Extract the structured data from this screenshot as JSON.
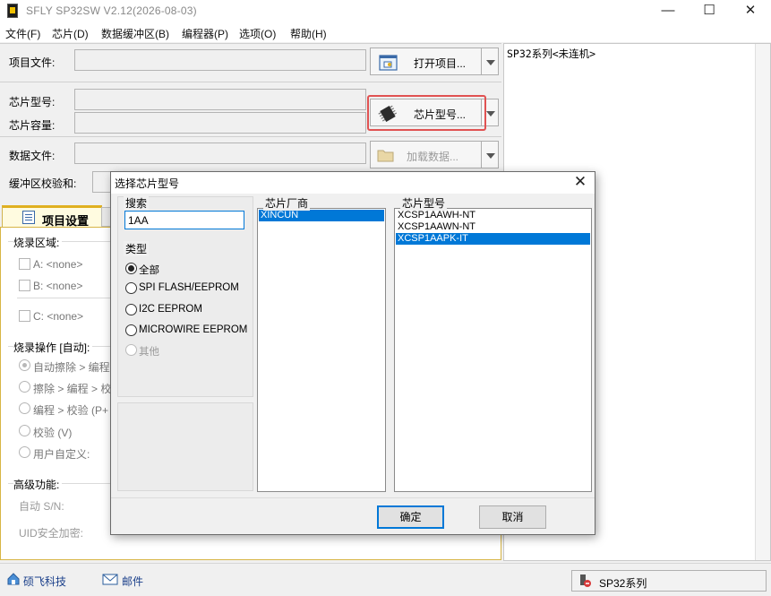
{
  "window": {
    "title": "SFLY SP32SW V2.12(2026-08-03)",
    "minimize": "—",
    "maximize": "☐",
    "close": "✕"
  },
  "menu": [
    "文件(F)",
    "芯片(D)",
    "数据缓冲区(B)",
    "编程器(P)",
    "选项(O)",
    "帮助(H)"
  ],
  "left": {
    "project_file_label": "项目文件:",
    "open_project_btn": "打开项目...",
    "chip_model_label": "芯片型号:",
    "chip_capacity_label": "芯片容量:",
    "chip_model_btn": "芯片型号...",
    "data_file_label": "数据文件:",
    "load_data_btn": "加载数据...",
    "buffer_checksum_label": "缓冲区校验和:"
  },
  "tabs": {
    "project_settings": "项目设置"
  },
  "settings": {
    "burn_area_title": "烧录区域:",
    "area_a": "A: <none>",
    "area_b": "B: <none>",
    "area_c": "C: <none>",
    "burn_ops_title": "烧录操作 [自动]:",
    "op1": "自动擦除 > 编程",
    "op2": "擦除 > 编程 > 校",
    "op3": "编程 > 校验 (P+",
    "op4": "校验 (V)",
    "op5": "用户自定义:",
    "advanced_title": "高级功能:",
    "auto_sn": "自动 S/N:",
    "uid_encrypt": "UID安全加密:"
  },
  "output": {
    "text": "SP32系列<未连机>"
  },
  "statusbar": {
    "company": "硕飞科技",
    "mail": "邮件",
    "device": "SP32系列"
  },
  "dialog": {
    "title": "选择芯片型号",
    "close": "✕",
    "search_label": "搜索",
    "search_value": "1AA",
    "type_label": "类型",
    "types": [
      {
        "label": "全部",
        "selected": true,
        "disabled": false
      },
      {
        "label": "SPI FLASH/EEPROM",
        "selected": false,
        "disabled": false
      },
      {
        "label": "I2C EEPROM",
        "selected": false,
        "disabled": false
      },
      {
        "label": "MICROWIRE EEPROM",
        "selected": false,
        "disabled": false
      },
      {
        "label": "其他",
        "selected": false,
        "disabled": true
      }
    ],
    "vendor_label": "芯片厂商",
    "vendors": [
      {
        "name": "XINCUN",
        "selected": true
      }
    ],
    "model_label": "芯片型号",
    "models": [
      {
        "name": "XCSP1AAWH-NT",
        "selected": false
      },
      {
        "name": "XCSP1AAWN-NT",
        "selected": false
      },
      {
        "name": "XCSP1AAPK-IT",
        "selected": true
      }
    ],
    "ok": "确定",
    "cancel": "取消"
  },
  "colors": {
    "selection": "#0078d7",
    "highlight_border": "#e05252",
    "tab_accent": "#e0b020",
    "link": "#1a3f8a"
  }
}
